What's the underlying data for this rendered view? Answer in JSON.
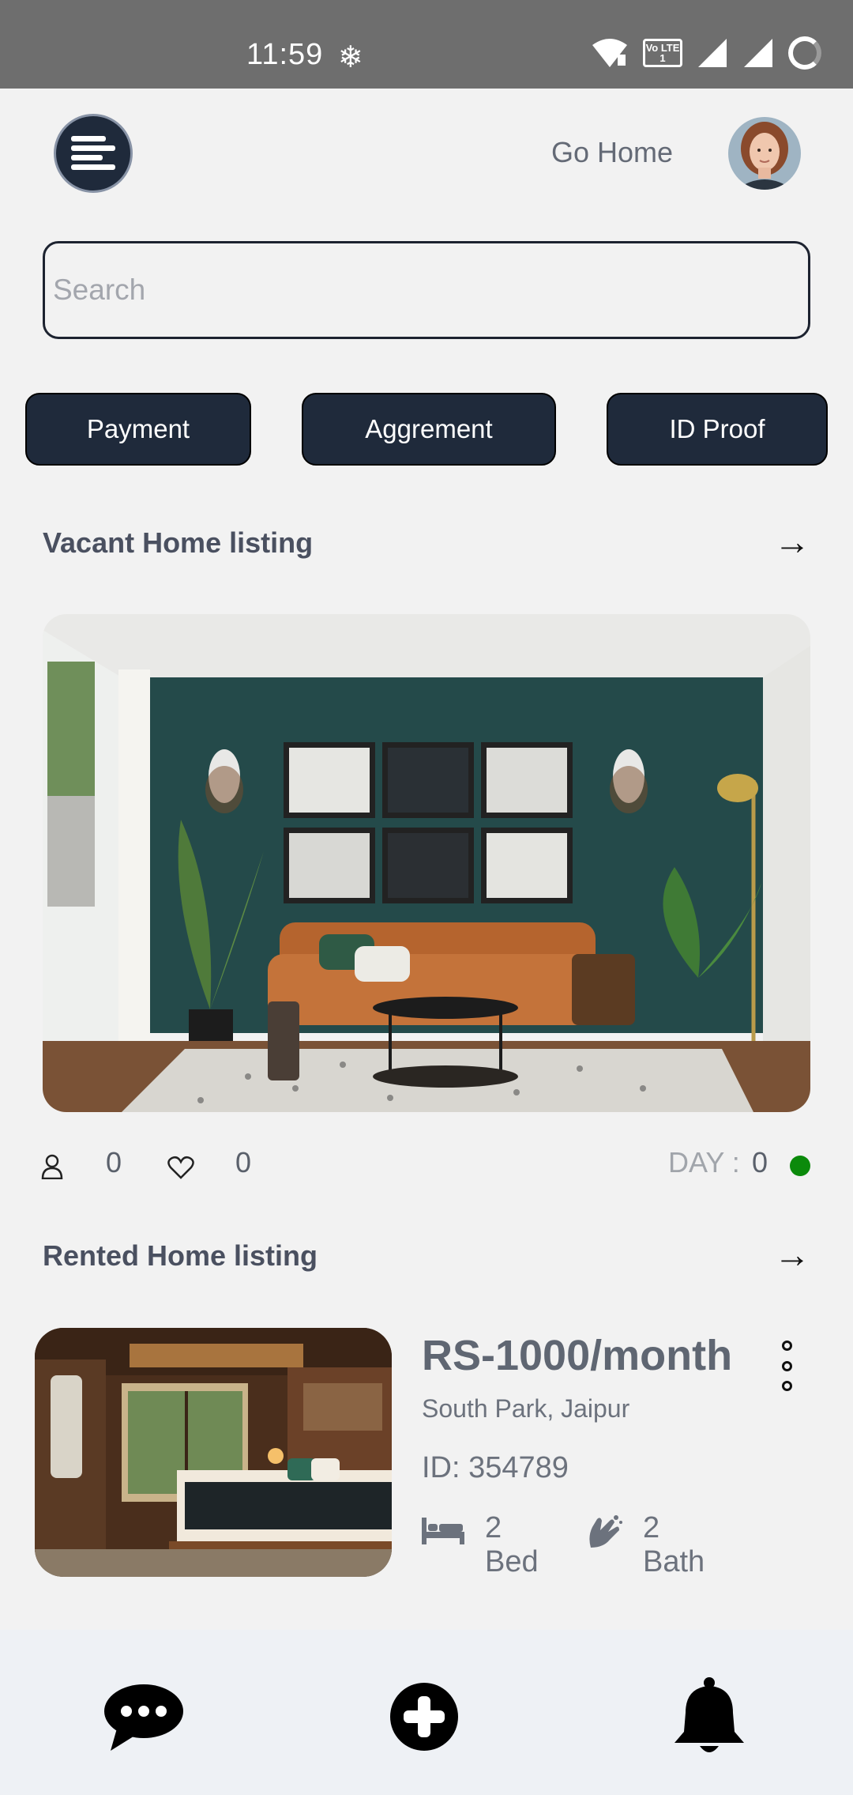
{
  "status_bar": {
    "time": "11:59",
    "lte_label": "Vo LTE 1"
  },
  "header": {
    "menu_icon": "menu-icon",
    "go_home_label": "Go Home",
    "avatar_icon": "profile-avatar"
  },
  "search": {
    "placeholder": "Search",
    "value": ""
  },
  "chips": [
    {
      "label": "Payment"
    },
    {
      "label": "Aggrement"
    },
    {
      "label": "ID Proof"
    }
  ],
  "vacant": {
    "title": "Vacant Home listing",
    "arrow": "→",
    "stats": {
      "user_count": "0",
      "like_count": "0",
      "day_label": "DAY :",
      "day_value": "0",
      "status_color": "#0b8a0b"
    }
  },
  "rented": {
    "title": "Rented Home listing",
    "arrow": "→",
    "listing": {
      "price": "RS-1000/month",
      "location": "South Park, Jaipur",
      "id": "ID: 354789",
      "beds": "2 Bed",
      "baths": "2 Bath"
    }
  },
  "bottom_nav": {
    "items": [
      "chat-icon",
      "add-icon",
      "bell-icon"
    ]
  },
  "colors": {
    "accent_dark": "#1f2a3b",
    "background": "#f2f2f2",
    "status_bar": "#6e6e6e"
  }
}
